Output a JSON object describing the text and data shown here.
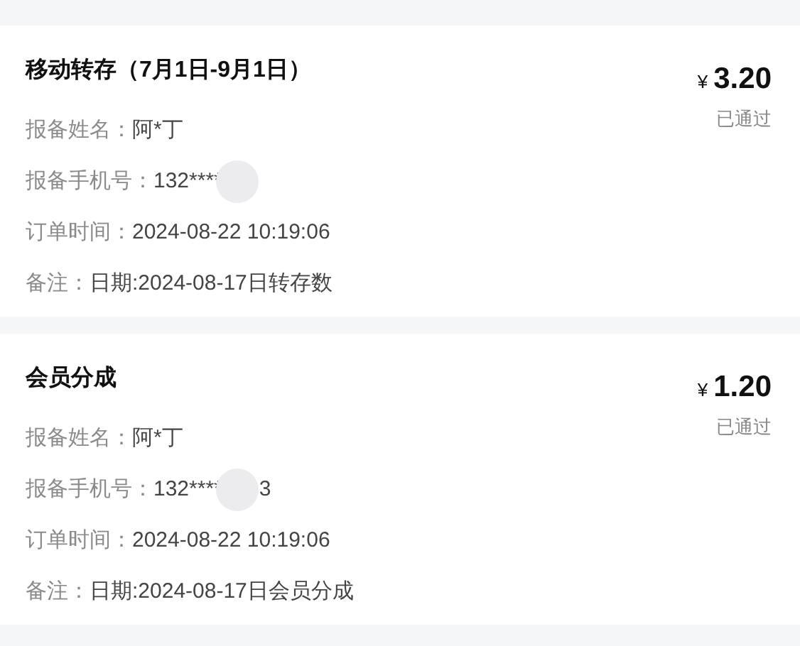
{
  "records": [
    {
      "title": "移动转存（7月1日-9月1日）",
      "currency": "¥",
      "amount": "3.20",
      "status": "已通过",
      "fields": [
        {
          "label": "报备姓名：",
          "value": "阿*丁"
        },
        {
          "label": "报备手机号：",
          "value": "132****",
          "redacted": true
        },
        {
          "label": "订单时间：",
          "value": "2024-08-22 10:19:06"
        },
        {
          "label": "备注：",
          "value": "日期:2024-08-17日转存数"
        }
      ]
    },
    {
      "title": "会员分成",
      "currency": "¥",
      "amount": "1.20",
      "status": "已通过",
      "fields": [
        {
          "label": "报备姓名：",
          "value": "阿*丁"
        },
        {
          "label": "报备手机号：",
          "value": "132****",
          "redacted": true,
          "tail": "3"
        },
        {
          "label": "订单时间：",
          "value": "2024-08-22 10:19:06"
        },
        {
          "label": "备注：",
          "value": "日期:2024-08-17日会员分成"
        }
      ]
    }
  ]
}
